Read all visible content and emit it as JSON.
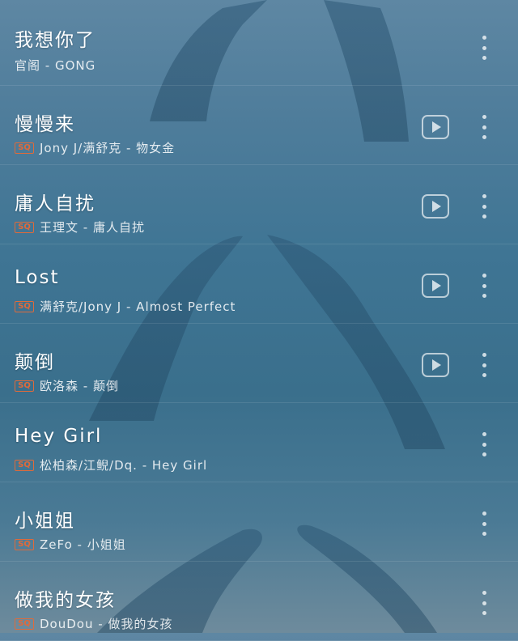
{
  "songs": [
    {
      "title": "我想你了",
      "subtitle": "官阁 - GONG",
      "sq": false,
      "play": false
    },
    {
      "title": "慢慢来",
      "subtitle": "Jony J/满舒克 - 物女金",
      "sq": true,
      "play": true
    },
    {
      "title": "庸人自扰",
      "subtitle": "王理文 - 庸人自扰",
      "sq": true,
      "play": true
    },
    {
      "title": "Lost",
      "subtitle": "满舒克/Jony J - Almost Perfect",
      "sq": true,
      "play": true
    },
    {
      "title": "颠倒",
      "subtitle": "欧洛森 - 颠倒",
      "sq": true,
      "play": true
    },
    {
      "title": "Hey Girl",
      "subtitle": "松柏森/江鲵/Dq. - Hey Girl",
      "sq": true,
      "play": false
    },
    {
      "title": "小姐姐",
      "subtitle": "ZeFo - 小姐姐",
      "sq": true,
      "play": false
    },
    {
      "title": "做我的女孩",
      "subtitle": "DouDou - 做我的女孩",
      "sq": true,
      "play": false
    }
  ],
  "badge_text": "SQ",
  "icons": {
    "play": "play-icon",
    "more": "more-vertical-icon",
    "badge": "sq-quality-icon"
  },
  "colors": {
    "badge": "#e06a3a",
    "background": "#3f7594"
  }
}
